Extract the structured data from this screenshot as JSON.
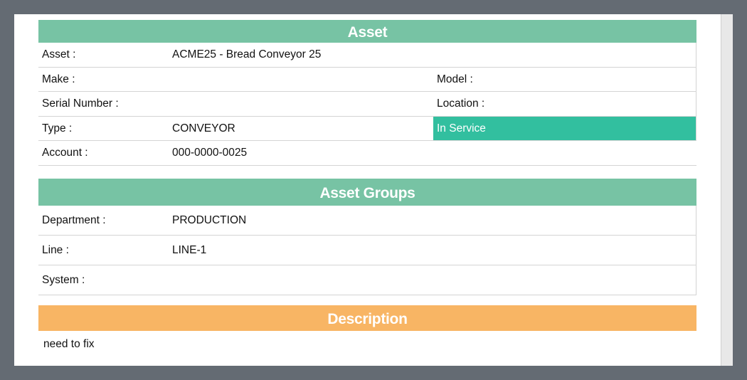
{
  "asset_section": {
    "title": "Asset",
    "rows": [
      {
        "label": "Asset :",
        "value": "ACME25 - Bread Conveyor 25"
      },
      {
        "label": "Make :",
        "label2": "Model :"
      },
      {
        "label": "Serial Number :",
        "label2": "Location :"
      },
      {
        "label": "Type :",
        "value": "CONVEYOR",
        "status": "In Service"
      },
      {
        "label": "Account :",
        "value": "000-0000-0025"
      }
    ]
  },
  "groups_section": {
    "title": "Asset Groups",
    "rows": [
      {
        "label": "Department :",
        "value": "PRODUCTION"
      },
      {
        "label": "Line :",
        "value": "LINE-1"
      },
      {
        "label": "System :",
        "value": ""
      }
    ]
  },
  "description_section": {
    "title": "Description",
    "text": "need to fix"
  },
  "colors": {
    "background": "#646b73",
    "header_green": "#77c3a4",
    "header_orange": "#f8b564",
    "status_green": "#32bf9f"
  }
}
